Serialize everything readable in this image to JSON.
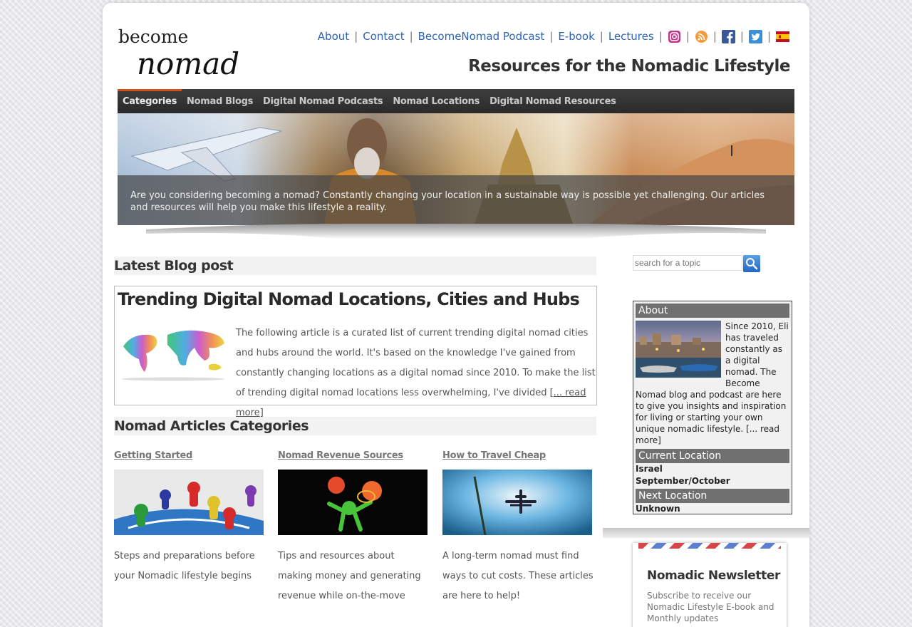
{
  "logo": {
    "line1": "become",
    "line2": "nomad"
  },
  "topnav": {
    "links": [
      "About",
      "Contact",
      "BecomeNomad Podcast",
      "E-book",
      "Lectures"
    ],
    "separator": "|",
    "icons": [
      "instagram-icon",
      "rss-icon",
      "facebook-icon",
      "twitter-icon",
      "spanish-flag-icon"
    ]
  },
  "tagline": "Resources for the Nomadic Lifestyle",
  "menu": {
    "items": [
      "Categories",
      "Nomad Blogs",
      "Digital Nomad Podcasts",
      "Nomad Locations",
      "Digital Nomad Resources"
    ],
    "active": "Categories"
  },
  "banner": {
    "caption": "Are you considering becoming a nomad? Constantly changing your location in a sustainable way is possible yet challenging. Our articles and resources will help you make this lifestyle a reality."
  },
  "latest": {
    "heading": "Latest Blog post",
    "title": "Trending Digital Nomad Locations, Cities and Hubs",
    "excerpt": "The following article is a curated list of current trending digital nomad cities and hubs around the world. It's based on the knowledge I've gained from constantly changing locations as a digital nomad since 2010. To make the list of trending digital nomad locations less overwhelming, I've divided [",
    "more": "... read more",
    "more_close": "]"
  },
  "categories": {
    "heading": "Nomad Articles Categories",
    "items": [
      {
        "title": "Getting Started",
        "desc": "Steps and preparations before your Nomadic lifestyle begins"
      },
      {
        "title": "Nomad Revenue Sources",
        "desc": "Tips and resources about making money and generating revenue while on-the-move"
      },
      {
        "title": "How to Travel Cheap",
        "desc": "A long-term nomad must find ways to cut costs. These articles are here to help!"
      }
    ]
  },
  "search": {
    "placeholder": "search for a topic"
  },
  "sidebar": {
    "about_head": "About",
    "about_text": "Since 2010, Eli has traveled constantly as a digital nomad. The Become Nomad blog and podcast are here to give you insights and inspiration for living or starting your own unique nomadic lifestyle. [",
    "about_more": "... read more",
    "about_close": "]",
    "current_head": "Current Location",
    "current_place": "Israel",
    "current_time": "September/October",
    "next_head": "Next Location",
    "next_place": "Unknown"
  },
  "newsletter": {
    "title": "Nomadic Newsletter",
    "text": "Subscribe to receive our Nomadic Lifestyle E-book and Monthly updates"
  },
  "colors": {
    "link": "#2d64b3",
    "menu_bg": "#333333",
    "menu_active": "#d2511b",
    "sidebar_head": "#707070"
  }
}
